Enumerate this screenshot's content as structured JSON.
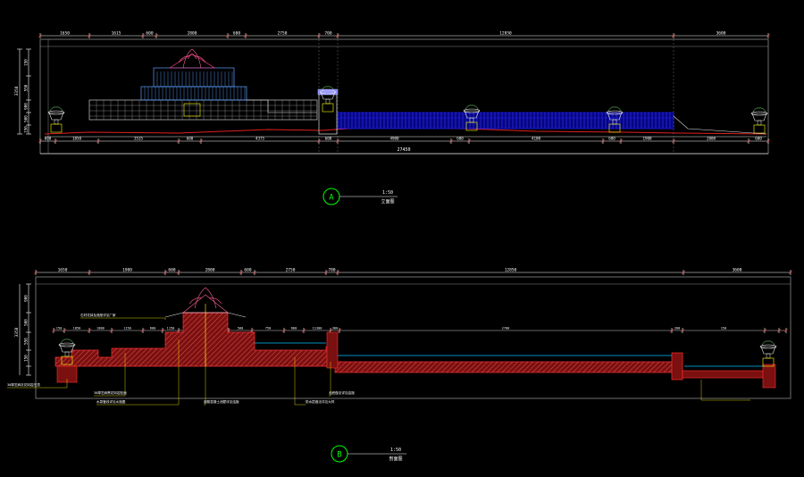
{
  "elevation_a": {
    "top_dims": [
      "1650",
      "1615",
      "600",
      "2800",
      "600",
      "2750",
      "700",
      "12850",
      "3600"
    ],
    "bottom_dims": [
      "600",
      "1850",
      "3535",
      "600",
      "4375",
      "600",
      "4900",
      "600",
      "4100",
      "600",
      "1900",
      "2000",
      "600"
    ],
    "overall": "27450",
    "left_dims": [
      "3358",
      "150",
      "550",
      "900",
      "500",
      "150"
    ],
    "tag_label": "A",
    "tag_scale": "1:50",
    "tag_title": "立面图"
  },
  "section_b": {
    "top_dims": [
      "1650",
      "1900",
      "600",
      "2800",
      "600",
      "2750",
      "700",
      "12850",
      "3600"
    ],
    "mid_dims": [
      "150",
      "1850",
      "1800",
      "1150",
      "600",
      "1150",
      "1000",
      "1150",
      "1750",
      "500",
      "750",
      "600",
      "11300",
      "300",
      "2700",
      "200",
      "150"
    ],
    "left_dims": [
      "3358",
      "900",
      "500",
      "550",
      "150"
    ],
    "callouts": [
      "石材花钵及底座详见厂家",
      "30厚芝麻灰花岗岩压顶",
      "30厚芝麻黑花岗岩贴面",
      "水泵管线详见水施图",
      "钢筋混凝土池壁详见结施",
      "防水层做法详见大样",
      "池底做法详见结施"
    ],
    "tag_label": "B",
    "tag_scale": "1:50",
    "tag_title": "剖面图"
  },
  "colors": {
    "background": "#000000",
    "dim": "#ffffff",
    "frame": "#8a8a8a",
    "structure": "#e8e8e8",
    "water": "#1a1aff",
    "section_fill": "#c81e1e",
    "leader": "#ffff00",
    "ground": "#e02020",
    "tag": "#00ff00",
    "accent": "#ff4040"
  }
}
